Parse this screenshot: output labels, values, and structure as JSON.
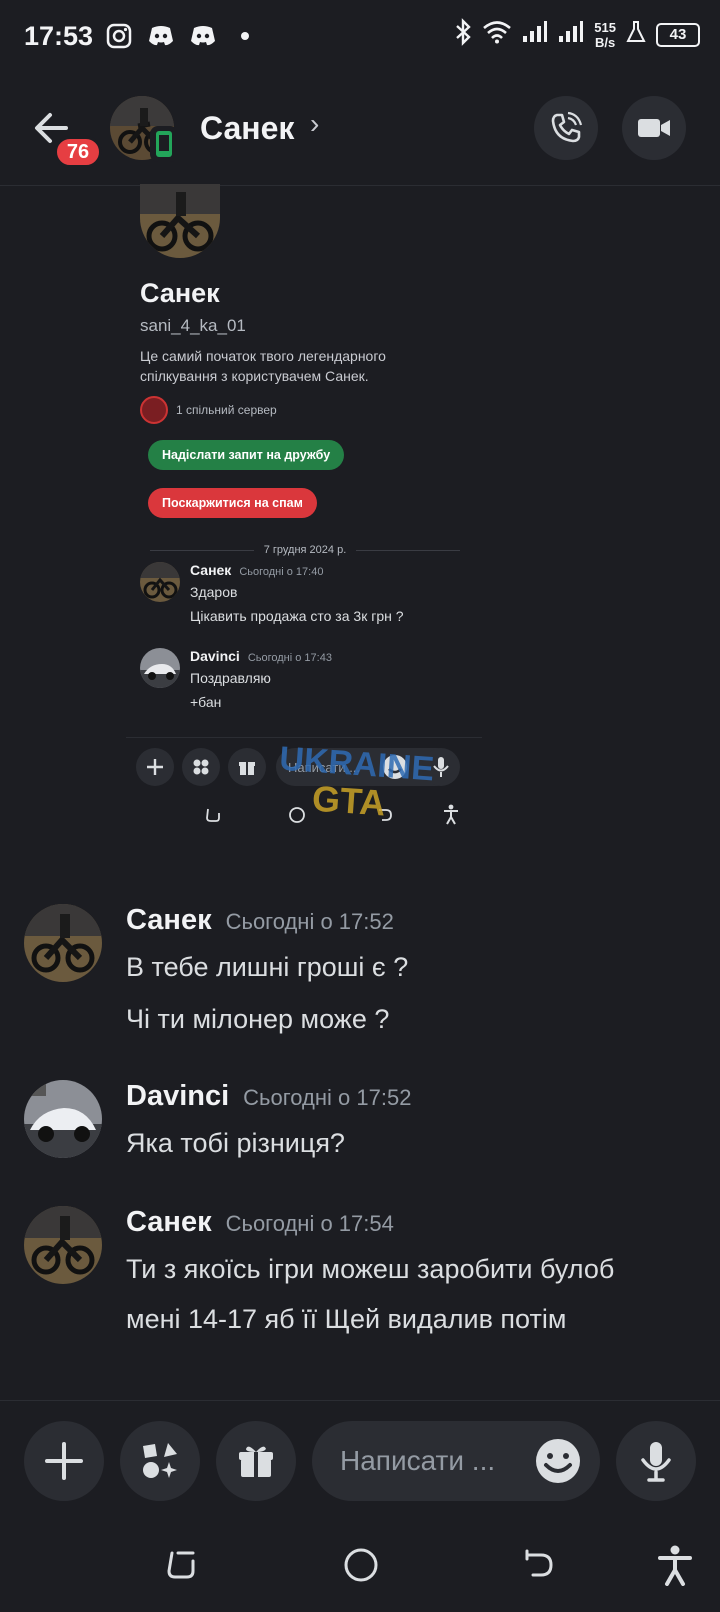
{
  "status_bar": {
    "time": "17:53",
    "net_speed_value": "515",
    "net_speed_unit": "B/s",
    "battery": "43"
  },
  "header": {
    "unread_badge": "76",
    "contact_name": "Санек",
    "chevron": "›"
  },
  "embedded_screenshot": {
    "profile_name": "Санек",
    "username": "sani_4_ka_01",
    "description": "Це самий початок твого легендарного спілкування з користувачем Санек.",
    "mutual_servers": "1 спільний сервер",
    "friend_request_button": "Надіслати запит на дружбу",
    "report_spam_button": "Поскаржитися на спам",
    "date_divider": "7 грудня 2024 р.",
    "messages": [
      {
        "author": "Санек",
        "time": "Сьогодні о 17:40",
        "lines": [
          "Здаров",
          "Цікавить продажа сто за 3к грн ?"
        ]
      },
      {
        "author": "Davinci",
        "time": "Сьогодні о 17:43",
        "lines": [
          "Поздравляю",
          "+бан"
        ]
      }
    ],
    "input_placeholder": "Написати ...",
    "watermark_line1": "UKRAINE",
    "watermark_line2": "GTA"
  },
  "messages": [
    {
      "author": "Санек",
      "time": "Сьогодні о 17:52",
      "lines": [
        "В тебе лишні гроші є ?",
        "Чі ти мілонер може ?"
      ]
    },
    {
      "author": "Davinci",
      "time": "Сьогодні о 17:52",
      "lines": [
        "Яка тобі різниця?"
      ]
    },
    {
      "author": "Санек",
      "time": "Сьогодні о 17:54",
      "lines": [
        "Ти з якоїсь ігри можеш заробити булоб",
        "мені 14-17 яб її Щей видалив потім"
      ]
    }
  ],
  "composer": {
    "placeholder": "Написати ..."
  },
  "icons": {
    "back": "arrow-left-icon",
    "call": "phone-icon",
    "video": "video-camera-icon",
    "add": "plus-icon",
    "apps": "apps-icon",
    "gift": "gift-icon",
    "emoji": "emoji-icon",
    "mic": "microphone-icon"
  },
  "colors": {
    "background": "#1c1d22",
    "surface": "#2b2d33",
    "badge_red": "#e63e42",
    "green_button": "#248046",
    "red_button": "#da373c",
    "mobile_indicator": "#23a55a"
  }
}
